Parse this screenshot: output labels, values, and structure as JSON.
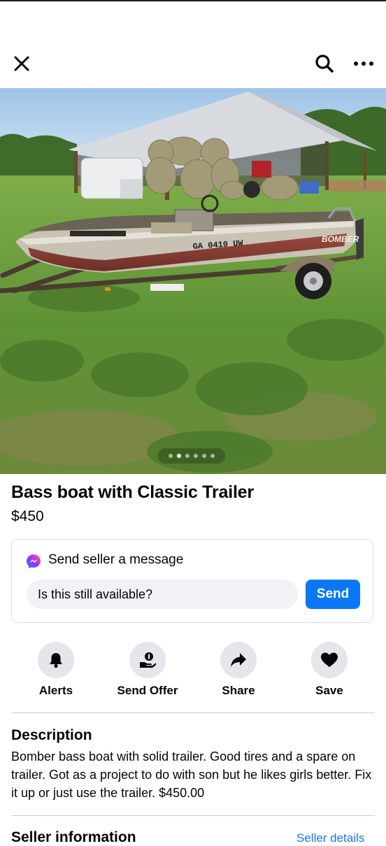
{
  "icons": {
    "close": "close-icon",
    "search": "search-icon",
    "more": "more-icon",
    "messenger": "messenger-icon",
    "bell": "bell-icon",
    "offer": "offer-icon",
    "share": "share-icon",
    "heart": "heart-icon"
  },
  "colors": {
    "accent": "#0a78f5",
    "link": "#1877f2",
    "input_bg": "#f0f2f5",
    "action_circle": "#e4e6eb"
  },
  "listing": {
    "title": "Bass boat with Classic Trailer",
    "price": "$450",
    "photo": {
      "alt": "Bomber bass boat on trailer in grassy field",
      "boat_brand_text": "BOMBER",
      "registration_text": "GA 0410 UW",
      "image_count": 6,
      "active_index": 1
    }
  },
  "message": {
    "title": "Send seller a message",
    "input_value": "Is this still available?",
    "send_label": "Send"
  },
  "actions": [
    {
      "label": "Alerts",
      "icon": "bell-icon"
    },
    {
      "label": "Send Offer",
      "icon": "offer-icon"
    },
    {
      "label": "Share",
      "icon": "share-icon"
    },
    {
      "label": "Save",
      "icon": "heart-icon"
    }
  ],
  "description": {
    "heading": "Description",
    "text": "Bomber bass boat with solid  trailer. Good tires and a spare on trailer. Got as a project to do with son but he likes girls better. Fix it up or just use the trailer. $450.00"
  },
  "seller": {
    "heading": "Seller information",
    "details_link": "Seller details"
  }
}
